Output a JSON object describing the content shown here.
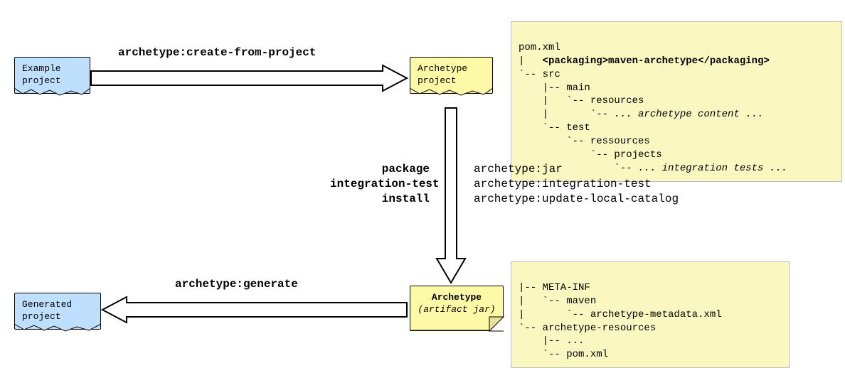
{
  "boxes": {
    "example_project": "Example\nproject",
    "generated_project": "Generated\nproject",
    "archetype_project": "Archetype\nproject",
    "archetype_title": "Archetype",
    "archetype_subtitle": "(artifact jar)"
  },
  "labels": {
    "create_from_project": "archetype:create-from-project",
    "generate": "archetype:generate",
    "lifecycle_bold": "package\nintegration-test\ninstall",
    "lifecycle_goals": "archetype:jar\narchetype:integration-test\narchetype:update-local-catalog"
  },
  "panels": {
    "top": {
      "line1": "pom.xml",
      "line2_pre": "|   ",
      "line2_tag_open": "<packaging>",
      "line2_tag_content": "maven-archetype",
      "line2_tag_close": "</packaging>",
      "line3": "`-- src",
      "line4": "    |-- main",
      "line5": "    |   `-- resources",
      "line6_pre": "    |       `-- ",
      "line6_italic": "... archetype content ...",
      "line7": "    `-- test",
      "line8": "        `-- ressources",
      "line9": "            `-- projects",
      "line10_pre": "                `-- ",
      "line10_italic": "... integration tests ..."
    },
    "bottom": {
      "line1": "|-- META-INF",
      "line2": "|   `-- maven",
      "line3": "|       `-- archetype-metadata.xml",
      "line4": "`-- archetype-resources",
      "line5": "    |-- ...",
      "line6": "    `-- pom.xml"
    }
  }
}
